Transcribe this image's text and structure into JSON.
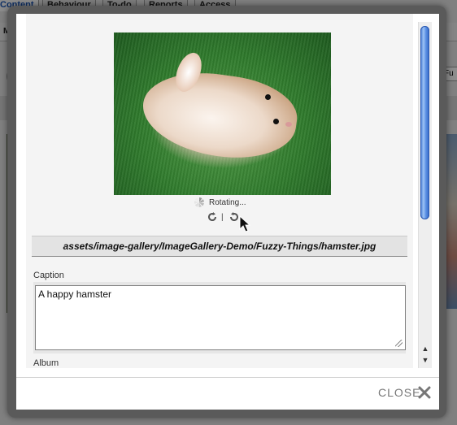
{
  "background": {
    "tabs": [
      "Content",
      "Behaviour",
      "To-do",
      "Reports",
      "Access"
    ],
    "toolbar_text": "Ma",
    "field_text": "Fu"
  },
  "modal": {
    "status_text": "Rotating...",
    "rotate_separator": "|",
    "file_path": "assets/image-gallery/ImageGallery-Demo/Fuzzy-Things/hamster.jpg",
    "caption_label": "Caption",
    "caption_value": "A happy hamster",
    "album_label": "Album",
    "close_label": "CLOSE"
  },
  "icons": {
    "spinner": "loading-spinner-icon",
    "rotate_left": "rotate-left-icon",
    "rotate_right": "rotate-right-icon",
    "close": "close-x-icon",
    "cursor": "mouse-pointer-icon"
  },
  "colors": {
    "scroll_thumb": "#3f74d1",
    "active_tab_text": "#1b57b8",
    "close_text": "#777777"
  }
}
